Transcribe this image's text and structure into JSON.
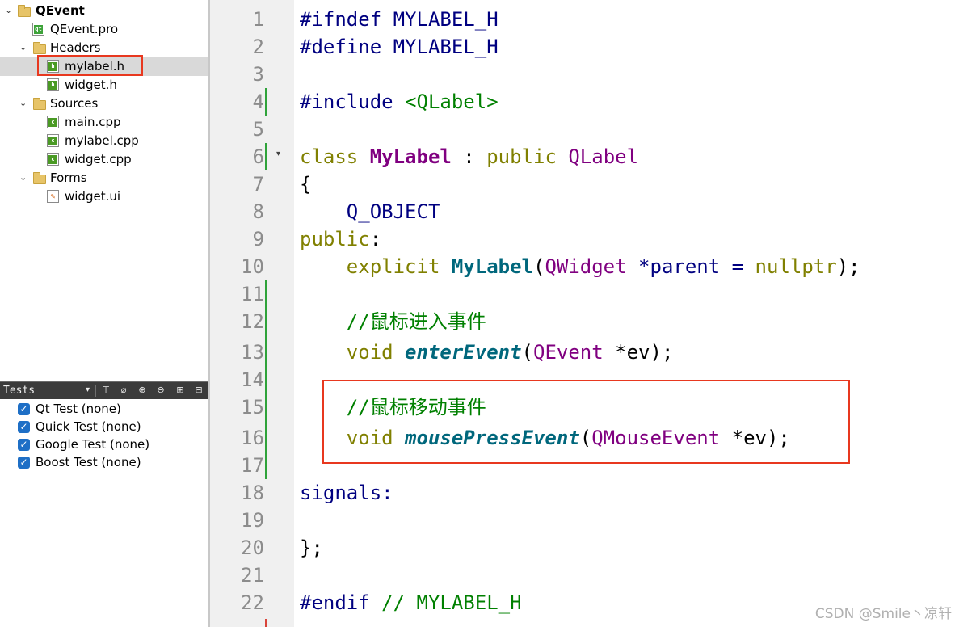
{
  "project_tree": {
    "project": "QEvent",
    "pro_file": "QEvent.pro",
    "headers_label": "Headers",
    "headers": [
      "mylabel.h",
      "widget.h"
    ],
    "sources_label": "Sources",
    "sources": [
      "main.cpp",
      "mylabel.cpp",
      "widget.cpp"
    ],
    "forms_label": "Forms",
    "forms": [
      "widget.ui"
    ],
    "selected": "mylabel.h"
  },
  "tests": {
    "title": "Tests",
    "items": [
      "Qt Test (none)",
      "Quick Test (none)",
      "Google Test (none)",
      "Boost Test (none)"
    ]
  },
  "editor": {
    "line_numbers": [
      "1",
      "2",
      "3",
      "4",
      "5",
      "6",
      "7",
      "8",
      "9",
      "10",
      "11",
      "12",
      "13",
      "14",
      "15",
      "16",
      "17",
      "18",
      "19",
      "20",
      "21",
      "22"
    ],
    "lines": {
      "l1_directive": "#ifndef",
      "l1_macro": " MYLABEL_H",
      "l2_directive": "#define",
      "l2_macro": " MYLABEL_H",
      "l4_directive": "#include",
      "l4_header": " <QLabel>",
      "l6_kw": "class",
      "l6_name": " MyLabel",
      "l6_colon": " :",
      "l6_access": " public",
      "l6_base": " QLabel",
      "l7": "{",
      "l8": "    Q_OBJECT",
      "l9_kw": "public",
      "l9_colon": ":",
      "l10_kw": "    explicit",
      "l10_fn": " MyLabel",
      "l10_open": "(",
      "l10_type": "QWidget",
      "l10_param": " *parent = ",
      "l10_null": "nullptr",
      "l10_close": ");",
      "l12_comment": "    //鼠标进入事件",
      "l13_kw": "    void",
      "l13_fn": " enterEvent",
      "l13_open": "(",
      "l13_type": "QEvent",
      "l13_rest": " *ev);",
      "l15_comment": "    //鼠标移动事件",
      "l16_kw": "    void",
      "l16_fn": " mousePressEvent",
      "l16_open": "(",
      "l16_type": "QMouseEvent",
      "l16_rest": " *ev);",
      "l18": "signals:",
      "l20": "};",
      "l22_directive": "#endif",
      "l22_comment": " // MYLABEL_H"
    }
  },
  "watermark": "CSDN @Smile丶凉轩"
}
